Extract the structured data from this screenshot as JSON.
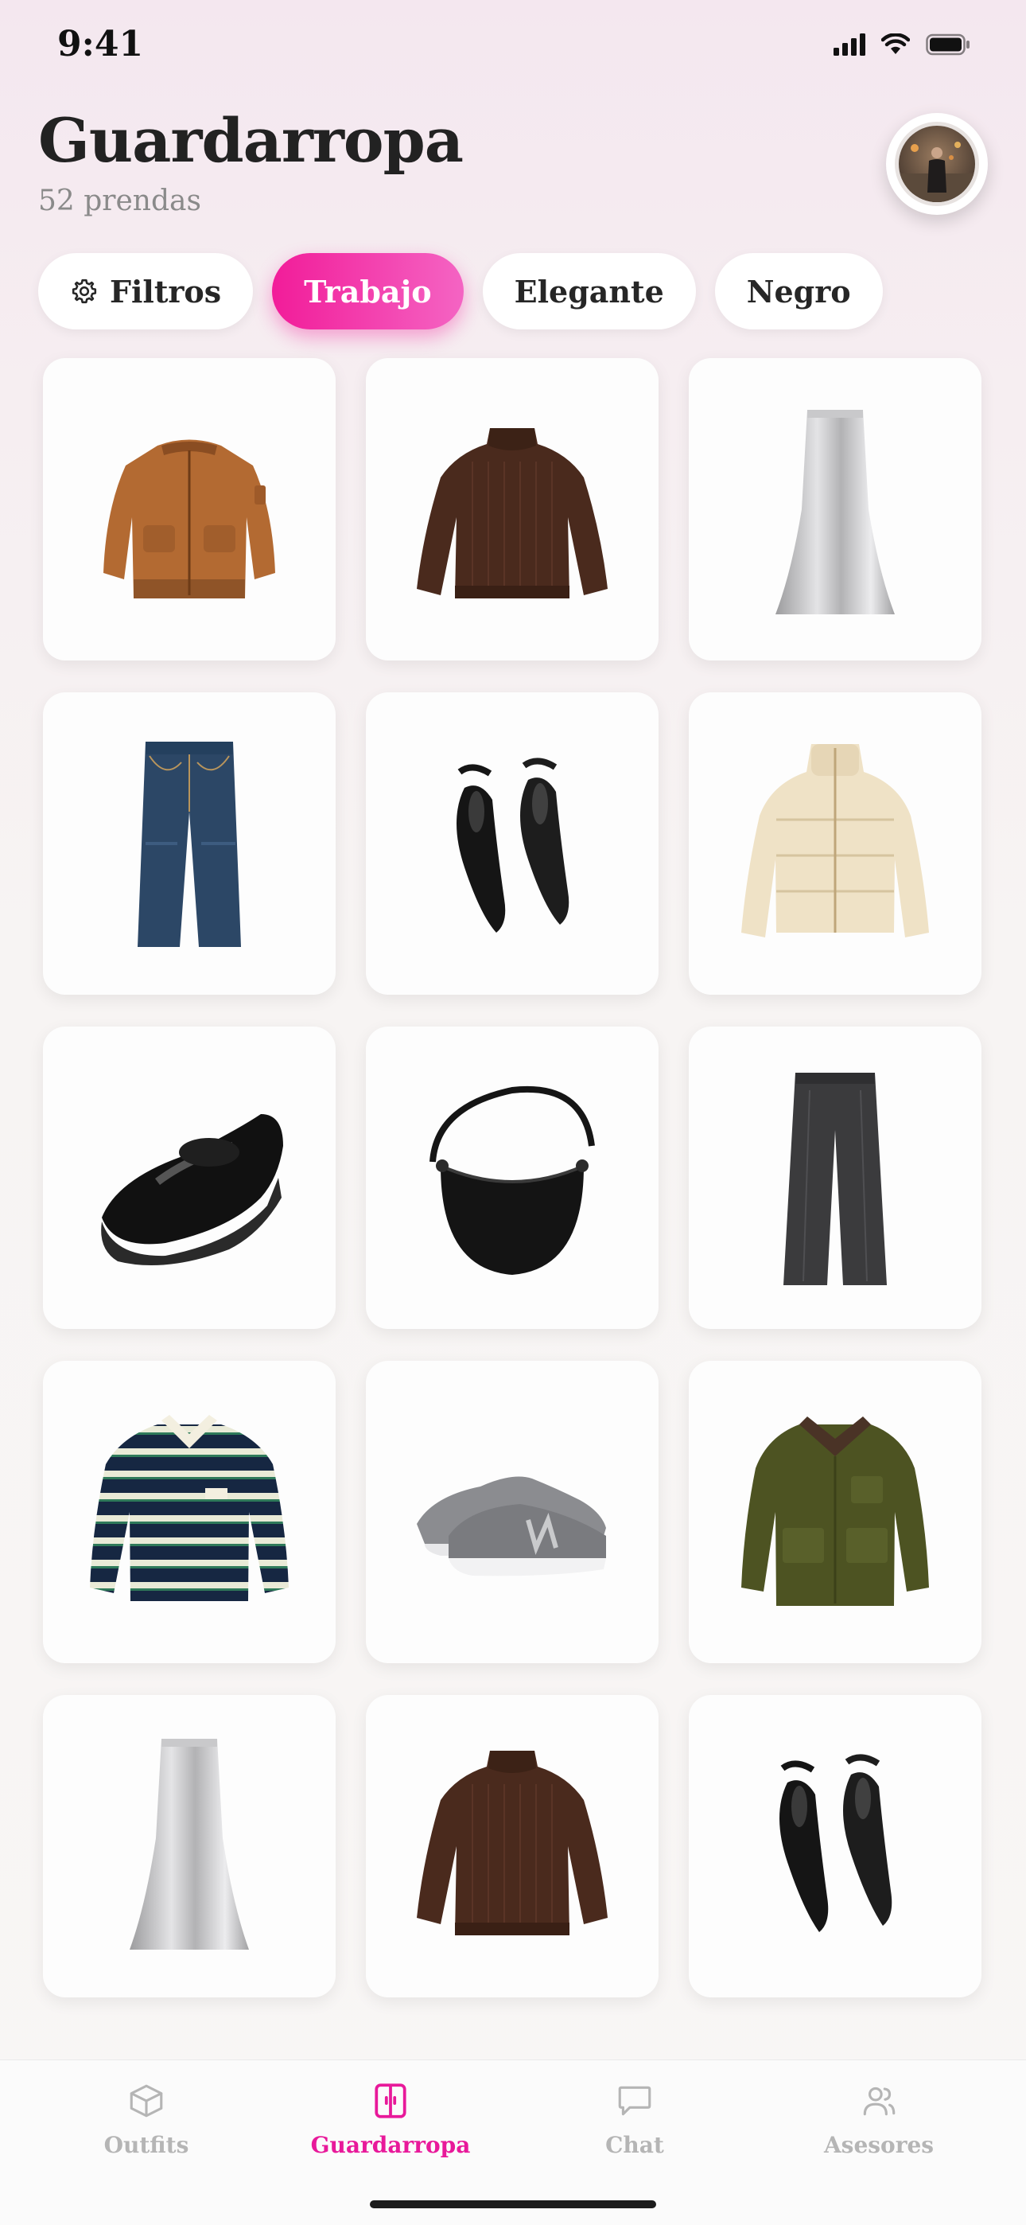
{
  "status": {
    "time": "9:41"
  },
  "header": {
    "title": "Guardarropa",
    "subtitle": "52 prendas"
  },
  "chips": [
    {
      "label": "Filtros",
      "icon": "gear-icon",
      "active": false
    },
    {
      "label": "Trabajo",
      "active": true
    },
    {
      "label": "Elegante",
      "active": false
    },
    {
      "label": "Negro",
      "active": false
    }
  ],
  "grid": {
    "items": [
      {
        "name": "leather-bomber-jacket"
      },
      {
        "name": "brown-knit-sweater"
      },
      {
        "name": "silver-satin-skirt"
      },
      {
        "name": "denim-jeans"
      },
      {
        "name": "black-pointed-flats"
      },
      {
        "name": "cream-puffer-jacket"
      },
      {
        "name": "black-chunky-loafer"
      },
      {
        "name": "black-crescent-bag"
      },
      {
        "name": "charcoal-wide-trousers"
      },
      {
        "name": "navy-striped-rugby-shirt"
      },
      {
        "name": "grey-sneakers"
      },
      {
        "name": "olive-corduroy-jacket"
      },
      {
        "name": "silver-satin-skirt"
      },
      {
        "name": "brown-knit-sweater"
      },
      {
        "name": "black-pointed-flats"
      }
    ]
  },
  "tabs": [
    {
      "label": "Outfits",
      "icon": "box-icon",
      "active": false
    },
    {
      "label": "Guardarropa",
      "icon": "wardrobe-icon",
      "active": true
    },
    {
      "label": "Chat",
      "icon": "chat-bubble-icon",
      "active": false
    },
    {
      "label": "Asesores",
      "icon": "people-icon",
      "active": false
    }
  ],
  "colors": {
    "accent": "#e8199a",
    "inactive": "#b5b5b5"
  }
}
